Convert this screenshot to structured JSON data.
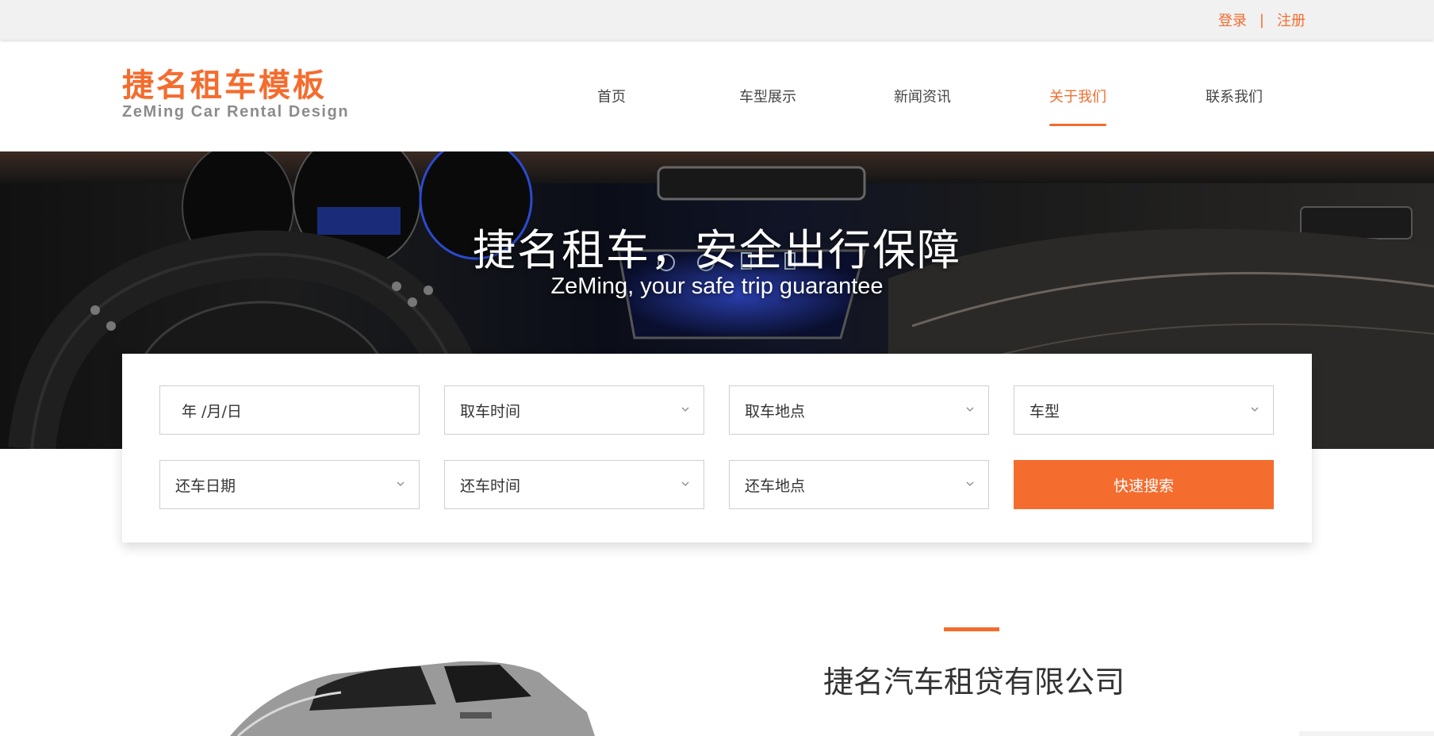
{
  "topbar": {
    "login": "登录",
    "separator": "|",
    "register": "注册"
  },
  "logo": {
    "cn": "捷名租车模板",
    "en": "ZeMing Car Rental Design"
  },
  "nav": {
    "items": [
      {
        "label": "首页",
        "active": false
      },
      {
        "label": "车型展示",
        "active": false
      },
      {
        "label": "新闻资讯",
        "active": false
      },
      {
        "label": "关于我们",
        "active": true
      },
      {
        "label": "联系我们",
        "active": false
      }
    ]
  },
  "hero": {
    "title": "捷名租车，安全出行保障",
    "subtitle": "ZeMing, your safe trip guarantee"
  },
  "search": {
    "pickup_date_placeholder": "年 /月/日",
    "pickup_time": "取车时间",
    "pickup_location": "取车地点",
    "car_type": "车型",
    "return_date": "还车日期",
    "return_time": "还车时间",
    "return_location": "还车地点",
    "submit_label": "快速搜索"
  },
  "about": {
    "title": "捷名汽车租贷有限公司"
  },
  "colors": {
    "accent": "#f46c2e",
    "topbar_bg": "#f1f1f1"
  }
}
